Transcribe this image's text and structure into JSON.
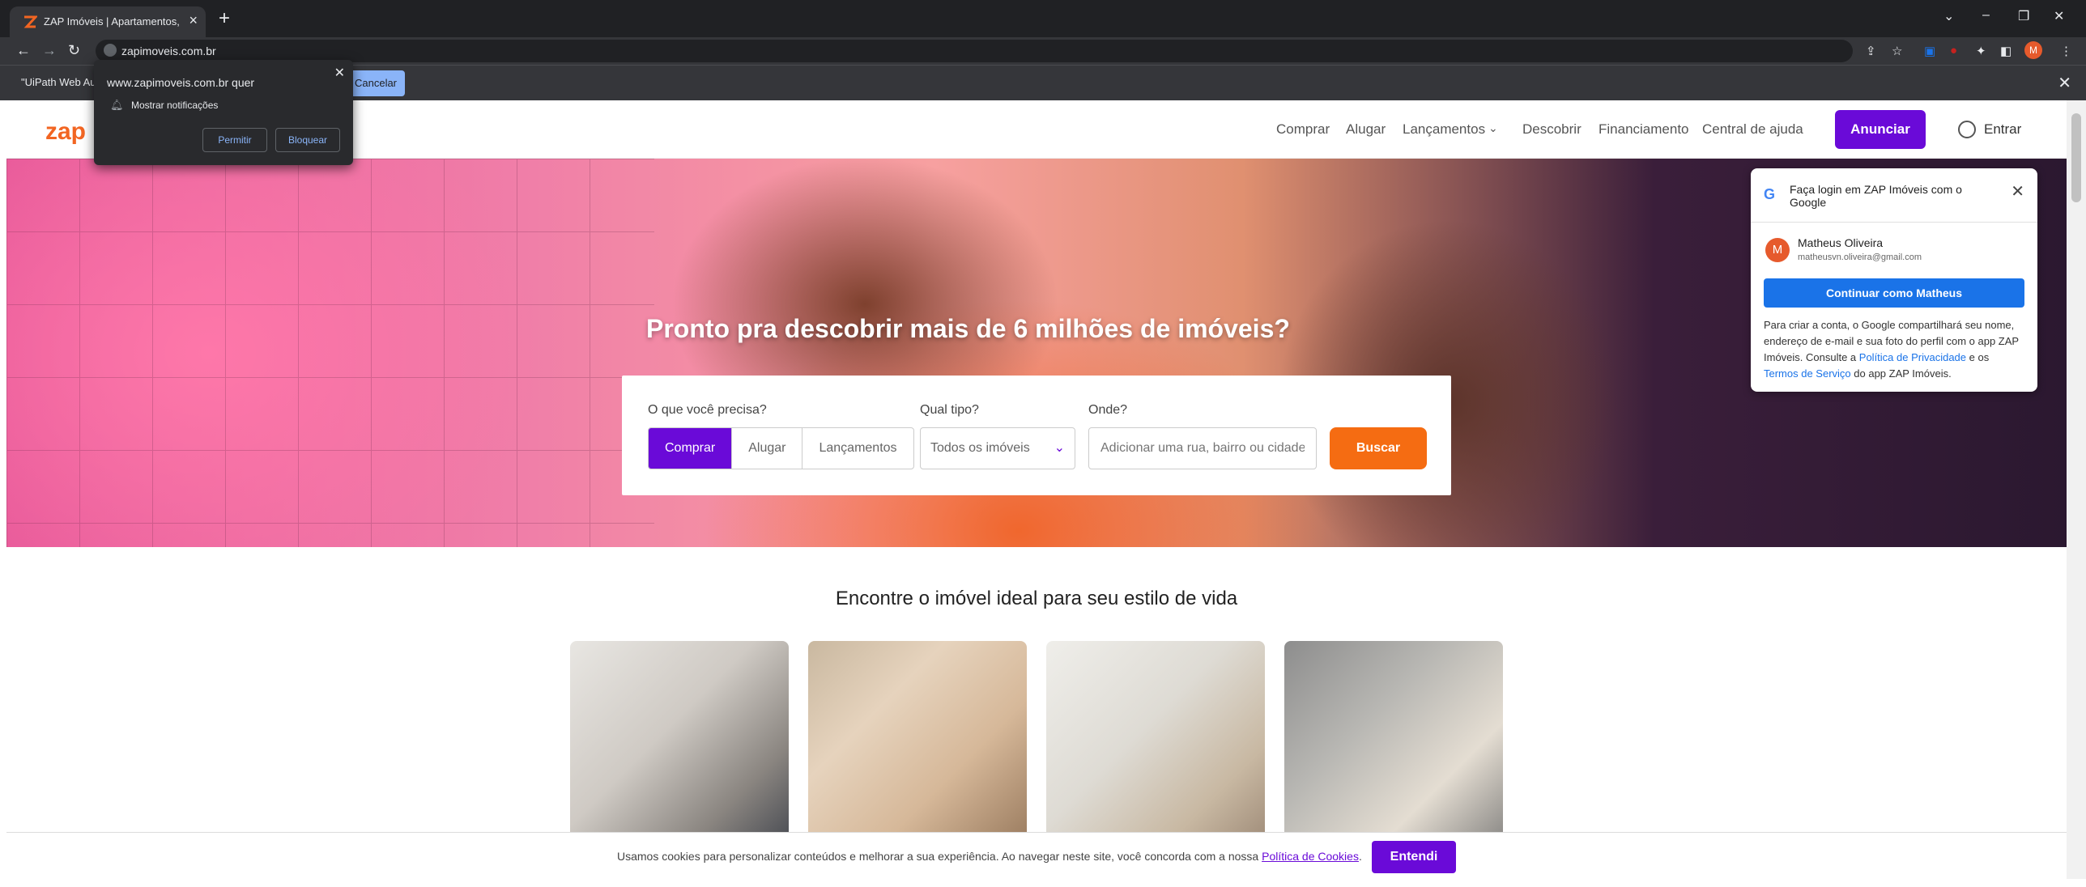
{
  "browser": {
    "tab_title": "ZAP Imóveis | Apartamentos, Ca",
    "url": "zapimoveis.com.br",
    "infobar_text": "\"UiPath Web Au",
    "infobar_cancel": "Cancelar",
    "profile_initial": "M"
  },
  "notification": {
    "title": "www.zapimoveis.com.br quer",
    "line": "Mostrar notificações",
    "allow": "Permitir",
    "block": "Bloquear"
  },
  "site": {
    "logo": "zap",
    "nav": [
      "Comprar",
      "Alugar",
      "Lançamentos",
      "Descobrir",
      "Financiamento",
      "Central de ajuda"
    ],
    "anunciar": "Anunciar",
    "entrar": "Entrar"
  },
  "hero": {
    "headline": "Pronto pra descobrir mais de 6 milhões de imóveis?",
    "label_need": "O que você precisa?",
    "label_type": "Qual tipo?",
    "label_where": "Onde?",
    "seg_buy": "Comprar",
    "seg_rent": "Alugar",
    "seg_launch": "Lançamentos",
    "type_value": "Todos os imóveis",
    "where_placeholder": "Adicionar uma rua, bairro ou cidade",
    "search_button": "Buscar"
  },
  "section": {
    "title": "Encontre o imóvel ideal para seu estilo de vida"
  },
  "cookie": {
    "text": "Usamos cookies para personalizar conteúdos e melhorar a sua experiência. Ao navegar neste site, você concorda com a nossa ",
    "link": "Política de Cookies",
    "period": ".",
    "button": "Entendi"
  },
  "google": {
    "title": "Faça login em ZAP Imóveis com o Google",
    "name": "Matheus Oliveira",
    "email": "matheusvn.oliveira@gmail.com",
    "avatar": "M",
    "continue": "Continuar como Matheus",
    "p1": "Para criar a conta, o Google compartilhará seu nome, endereço de e-mail e sua foto do perfil com o app ZAP Imóveis. Consulte a ",
    "privacy": "Política de Privacidade",
    "p2": " e os ",
    "terms": "Termos de Serviço",
    "p3": " do app ZAP Imóveis."
  },
  "colors": {
    "brand_purple": "#6a0ad8",
    "brand_orange": "#f56c12",
    "google_blue": "#1a73e8"
  }
}
